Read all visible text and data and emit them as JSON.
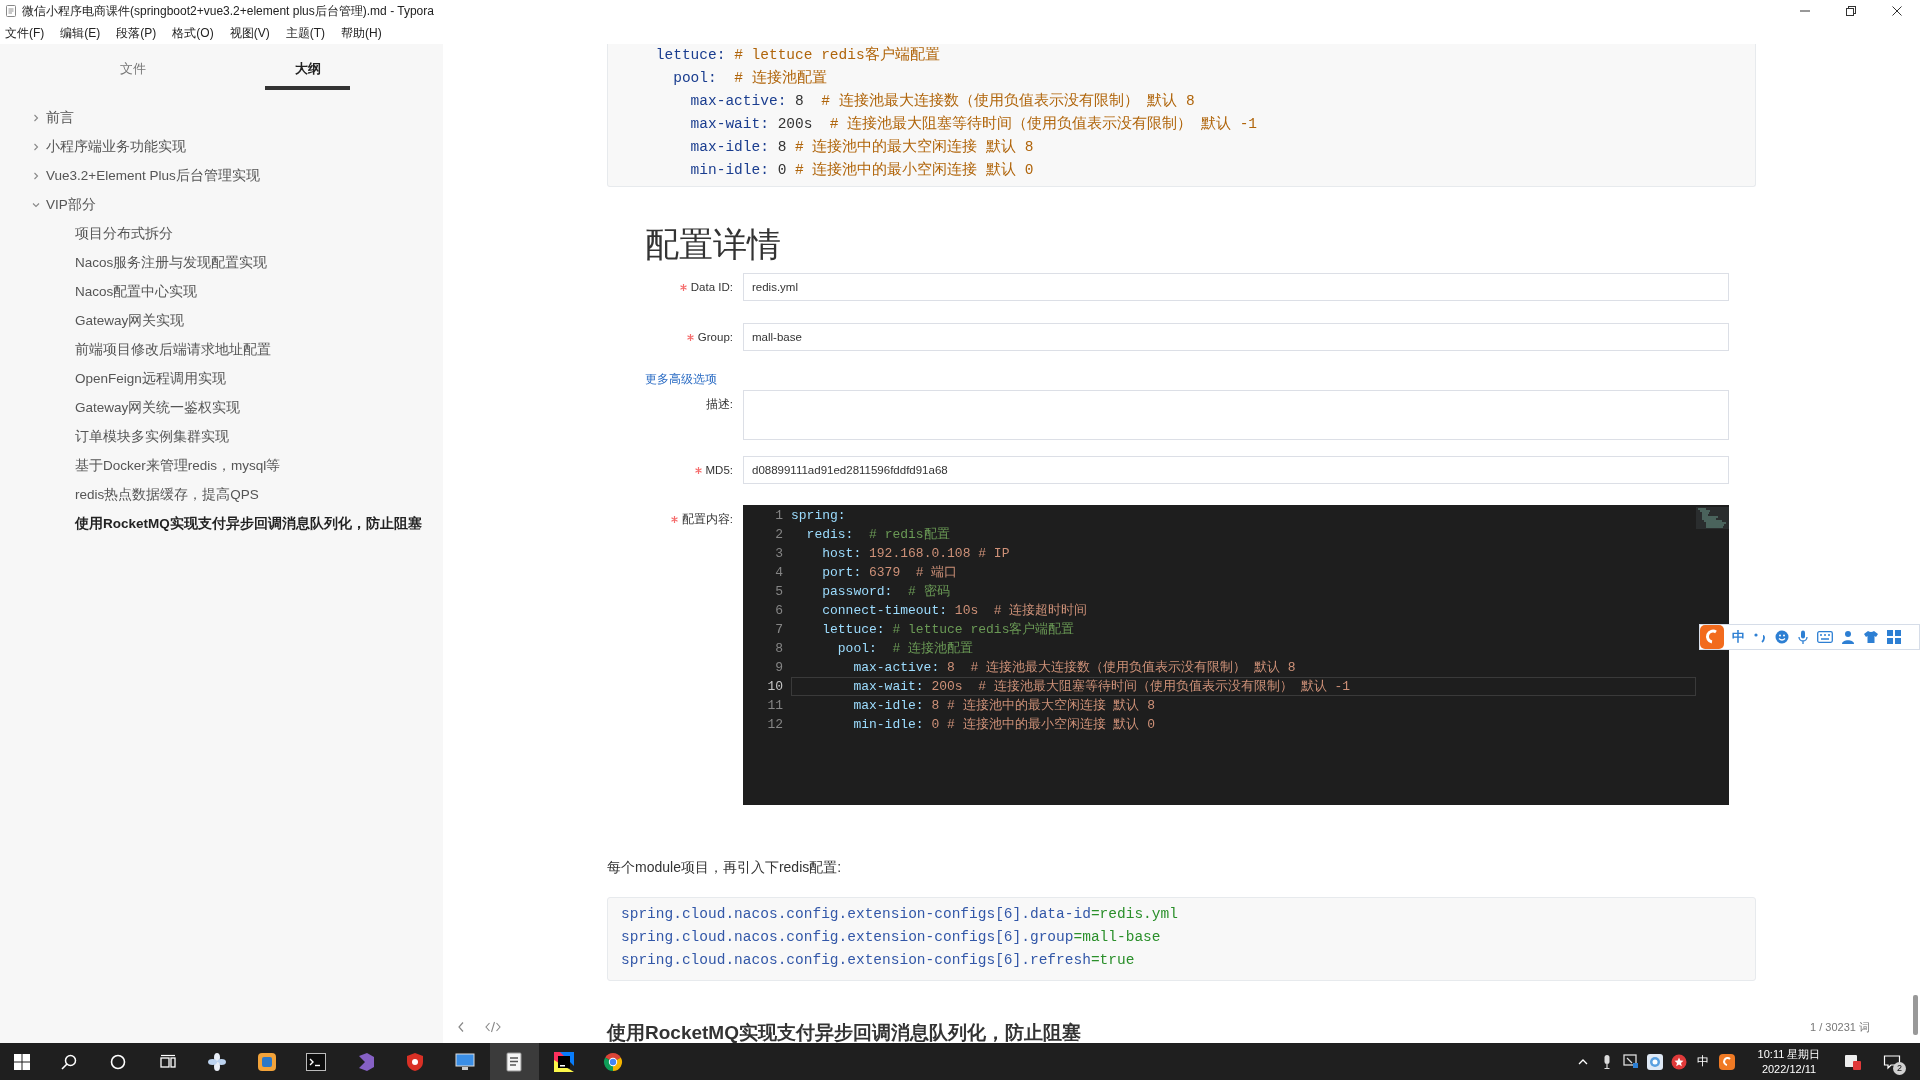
{
  "window": {
    "title": "微信小程序电商课件(springboot2+vue3.2+element plus后台管理).md - Typora"
  },
  "menu": [
    "文件(F)",
    "编辑(E)",
    "段落(P)",
    "格式(O)",
    "视图(V)",
    "主题(T)",
    "帮助(H)"
  ],
  "sidebar": {
    "tabs": [
      {
        "label": "文件",
        "selected": false
      },
      {
        "label": "大纲",
        "selected": true
      }
    ],
    "outline": [
      {
        "label": "前言",
        "expanded": false,
        "selected": false
      },
      {
        "label": "小程序端业务功能实现",
        "expanded": false,
        "selected": false
      },
      {
        "label": "Vue3.2+Element Plus后台管理实现",
        "expanded": false,
        "selected": false
      },
      {
        "label": "VIP部分",
        "expanded": true,
        "selected": false,
        "children": [
          {
            "label": "项目分布式拆分",
            "selected": false
          },
          {
            "label": "Nacos服务注册与发现配置实现",
            "selected": false
          },
          {
            "label": "Nacos配置中心实现",
            "selected": false
          },
          {
            "label": "Gateway网关实现",
            "selected": false
          },
          {
            "label": "前端项目修改后端请求地址配置",
            "selected": false
          },
          {
            "label": "OpenFeign远程调用实现",
            "selected": false
          },
          {
            "label": "Gateway网关统一鉴权实现",
            "selected": false
          },
          {
            "label": "订单模块多实例集群实现",
            "selected": false
          },
          {
            "label": "基于Docker来管理redis，mysql等",
            "selected": false
          },
          {
            "label": "redis热点数据缓存，提高QPS",
            "selected": false
          },
          {
            "label": "使用RocketMQ实现支付异步回调消息队列化，防止阻塞",
            "selected": true
          }
        ]
      }
    ]
  },
  "document": [
    {
      "kind": "yaml",
      "lines": [
        "    lettuce: # lettuce redis客户端配置",
        "      pool:  # 连接池配置",
        "        max-active: 8  # 连接池最大连接数（使用负值表示没有限制） 默认 8",
        "        max-wait: 200s  # 连接池最大阻塞等待时间（使用负值表示没有限制） 默认 -1",
        "        max-idle: 8 # 连接池中的最大空闲连接 默认 8",
        "        min-idle: 0 # 连接池中的最小空闲连接 默认 0"
      ]
    },
    {
      "kind": "screenshot",
      "heading": "配置详情",
      "fields": [
        {
          "kind": "input",
          "label": "Data ID:",
          "required": true,
          "value": "redis.yml"
        },
        {
          "kind": "input",
          "label": "Group:",
          "required": true,
          "value": "mall-base"
        },
        {
          "kind": "link",
          "text": "更多高级选项"
        },
        {
          "kind": "textarea",
          "label": "描述:",
          "required": false
        },
        {
          "kind": "input",
          "label": "MD5:",
          "required": true,
          "value": "d08899111ad91ed2811596fddfd91a68"
        },
        {
          "kind": "editor",
          "label": "配置内容:",
          "required": true,
          "lines": [
            {
              "number": "1",
              "text": "spring:",
              "highlighted": false
            },
            {
              "number": "2",
              "text": "  redis:  # redis配置",
              "highlighted": false
            },
            {
              "number": "3",
              "text": "    host: 192.168.0.108 # IP",
              "highlighted": false
            },
            {
              "number": "4",
              "text": "    port: 6379  # 端口",
              "highlighted": false
            },
            {
              "number": "5",
              "text": "    password:  # 密码",
              "highlighted": false
            },
            {
              "number": "6",
              "text": "    connect-timeout: 10s  # 连接超时时间",
              "highlighted": false
            },
            {
              "number": "7",
              "text": "    lettuce: # lettuce redis客户端配置",
              "highlighted": false
            },
            {
              "number": "8",
              "text": "      pool:  # 连接池配置",
              "highlighted": false
            },
            {
              "number": "9",
              "text": "        max-active: 8  # 连接池最大连接数（使用负值表示没有限制） 默认 8",
              "highlighted": false
            },
            {
              "number": "10",
              "text": "        max-wait: 200s  # 连接池最大阻塞等待时间（使用负值表示没有限制） 默认 -1",
              "highlighted": true
            },
            {
              "number": "11",
              "text": "        max-idle: 8 # 连接池中的最大空闲连接 默认 8",
              "highlighted": false
            },
            {
              "number": "12",
              "text": "        min-idle: 0 # 连接池中的最小空闲连接 默认 0",
              "highlighted": false
            }
          ]
        }
      ]
    },
    {
      "kind": "paragraph",
      "text": "每个module项目，再引入下redis配置:"
    },
    {
      "kind": "properties",
      "lines": [
        "spring.cloud.nacos.config.extension-configs[6].data-id=redis.yml",
        "spring.cloud.nacos.config.extension-configs[6].group=mall-base",
        "spring.cloud.nacos.config.extension-configs[6].refresh=true"
      ]
    },
    {
      "kind": "heading",
      "text": "使用RocketMQ实现支付异步回调消息队列化，防止阻塞"
    }
  ],
  "footer": {
    "word_count": "1 / 30231 词"
  },
  "ime_toolbar": {
    "mode": "中"
  },
  "taskbar": {
    "apps": [
      {
        "kind": "pinwheel",
        "selected": false
      },
      {
        "kind": "tile",
        "selected": false
      },
      {
        "kind": "terminal",
        "selected": false
      },
      {
        "kind": "ribbon",
        "selected": false
      },
      {
        "kind": "shield",
        "selected": false
      },
      {
        "kind": "monitor",
        "selected": false
      },
      {
        "kind": "document",
        "selected": true
      },
      {
        "kind": "ide",
        "selected": false
      },
      {
        "kind": "browser",
        "selected": false
      }
    ],
    "tray": {
      "ime": "中",
      "time": "10:11 星期日",
      "date": "2022/12/11",
      "notification_count": "2"
    }
  }
}
